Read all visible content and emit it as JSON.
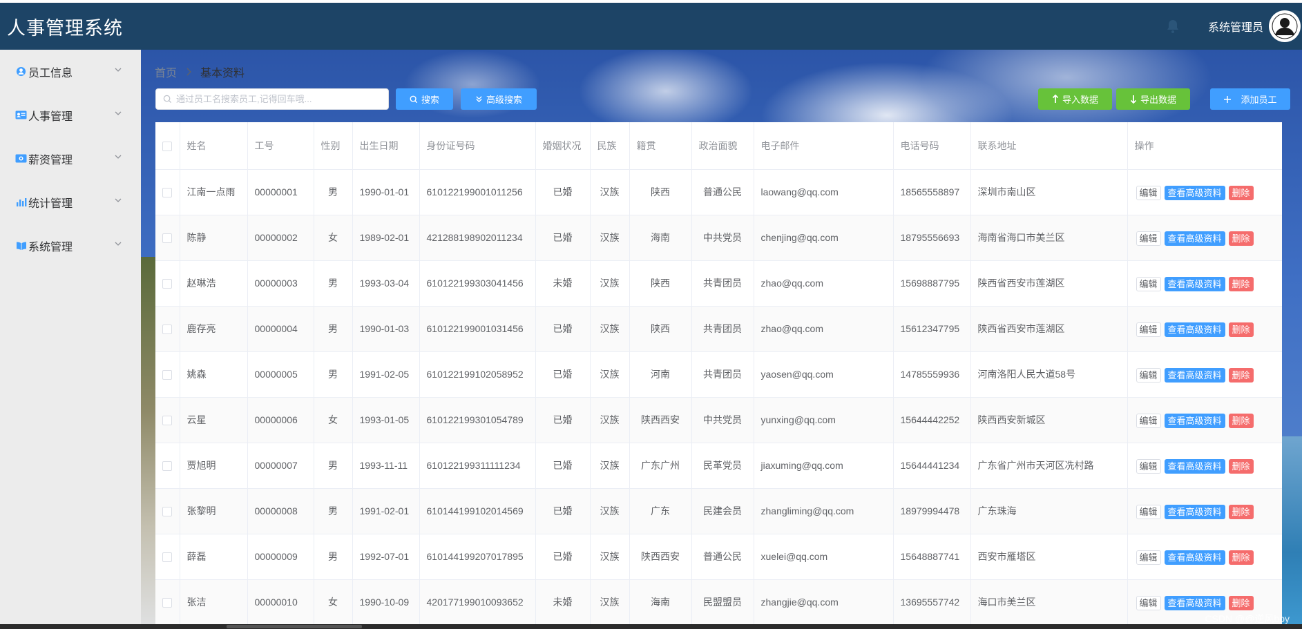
{
  "header": {
    "title": "人事管理系统",
    "user_name": "系统管理员"
  },
  "sidebar": {
    "items": [
      {
        "label": "员工信息",
        "icon": "user-circle-icon"
      },
      {
        "label": "人事管理",
        "icon": "id-card-icon"
      },
      {
        "label": "薪资管理",
        "icon": "money-icon"
      },
      {
        "label": "统计管理",
        "icon": "bar-chart-icon"
      },
      {
        "label": "系统管理",
        "icon": "book-icon"
      }
    ]
  },
  "breadcrumb": {
    "home": "首页",
    "current": "基本资料"
  },
  "toolbar": {
    "search_placeholder": "通过员工名搜索员工,记得回车哦...",
    "search_label": "搜索",
    "advanced_label": "高级搜索",
    "import_label": "导入数据",
    "export_label": "导出数据",
    "add_label": "添加员工"
  },
  "table": {
    "columns": [
      "姓名",
      "工号",
      "性别",
      "出生日期",
      "身份证号码",
      "婚姻状况",
      "民族",
      "籍贯",
      "政治面貌",
      "电子邮件",
      "电话号码",
      "联系地址",
      "操作"
    ],
    "rows": [
      {
        "name": "江南一点雨",
        "id": "00000001",
        "gender": "男",
        "birthday": "1990-01-01",
        "idcard": "610122199001011256",
        "marital": "已婚",
        "nation": "汉族",
        "native": "陕西",
        "politic": "普通公民",
        "email": "laowang@qq.com",
        "phone": "18565558897",
        "address": "深圳市南山区"
      },
      {
        "name": "陈静",
        "id": "00000002",
        "gender": "女",
        "birthday": "1989-02-01",
        "idcard": "421288198902011234",
        "marital": "已婚",
        "nation": "汉族",
        "native": "海南",
        "politic": "中共党员",
        "email": "chenjing@qq.com",
        "phone": "18795556693",
        "address": "海南省海口市美兰区"
      },
      {
        "name": "赵琳浩",
        "id": "00000003",
        "gender": "男",
        "birthday": "1993-03-04",
        "idcard": "610122199303041456",
        "marital": "未婚",
        "nation": "汉族",
        "native": "陕西",
        "politic": "共青团员",
        "email": "zhao@qq.com",
        "phone": "15698887795",
        "address": "陕西省西安市莲湖区"
      },
      {
        "name": "鹿存亮",
        "id": "00000004",
        "gender": "男",
        "birthday": "1990-01-03",
        "idcard": "610122199001031456",
        "marital": "已婚",
        "nation": "汉族",
        "native": "陕西",
        "politic": "共青团员",
        "email": "zhao@qq.com",
        "phone": "15612347795",
        "address": "陕西省西安市莲湖区"
      },
      {
        "name": "姚森",
        "id": "00000005",
        "gender": "男",
        "birthday": "1991-02-05",
        "idcard": "610122199102058952",
        "marital": "已婚",
        "nation": "汉族",
        "native": "河南",
        "politic": "共青团员",
        "email": "yaosen@qq.com",
        "phone": "14785559936",
        "address": "河南洛阳人民大道58号"
      },
      {
        "name": "云星",
        "id": "00000006",
        "gender": "女",
        "birthday": "1993-01-05",
        "idcard": "610122199301054789",
        "marital": "已婚",
        "nation": "汉族",
        "native": "陕西西安",
        "politic": "中共党员",
        "email": "yunxing@qq.com",
        "phone": "15644442252",
        "address": "陕西西安新城区"
      },
      {
        "name": "贾旭明",
        "id": "00000007",
        "gender": "男",
        "birthday": "1993-11-11",
        "idcard": "610122199311111234",
        "marital": "已婚",
        "nation": "汉族",
        "native": "广东广州",
        "politic": "民革党员",
        "email": "jiaxuming@qq.com",
        "phone": "15644441234",
        "address": "广东省广州市天河区冼村路"
      },
      {
        "name": "张黎明",
        "id": "00000008",
        "gender": "男",
        "birthday": "1991-02-01",
        "idcard": "610144199102014569",
        "marital": "已婚",
        "nation": "汉族",
        "native": "广东",
        "politic": "民建会员",
        "email": "zhangliming@qq.com",
        "phone": "18979994478",
        "address": "广东珠海"
      },
      {
        "name": "薛磊",
        "id": "00000009",
        "gender": "男",
        "birthday": "1992-07-01",
        "idcard": "610144199207017895",
        "marital": "已婚",
        "nation": "汉族",
        "native": "陕西西安",
        "politic": "普通公民",
        "email": "xuelei@qq.com",
        "phone": "15648887741",
        "address": "西安市雁塔区"
      },
      {
        "name": "张洁",
        "id": "00000010",
        "gender": "女",
        "birthday": "1990-10-09",
        "idcard": "420177199010093652",
        "marital": "未婚",
        "nation": "汉族",
        "native": "海南",
        "politic": "民盟盟员",
        "email": "zhangjie@qq.com",
        "phone": "13695557742",
        "address": "海口市美兰区"
      }
    ],
    "actions": {
      "edit": "编辑",
      "view": "查看高级资料",
      "delete": "删除"
    }
  },
  "watermark": "CSDN @@逆风boy",
  "colors": {
    "header": "#1d4466",
    "primary": "#409eff",
    "success": "#67c23a",
    "danger": "#f56c6c",
    "sidebar": "#ececec"
  }
}
